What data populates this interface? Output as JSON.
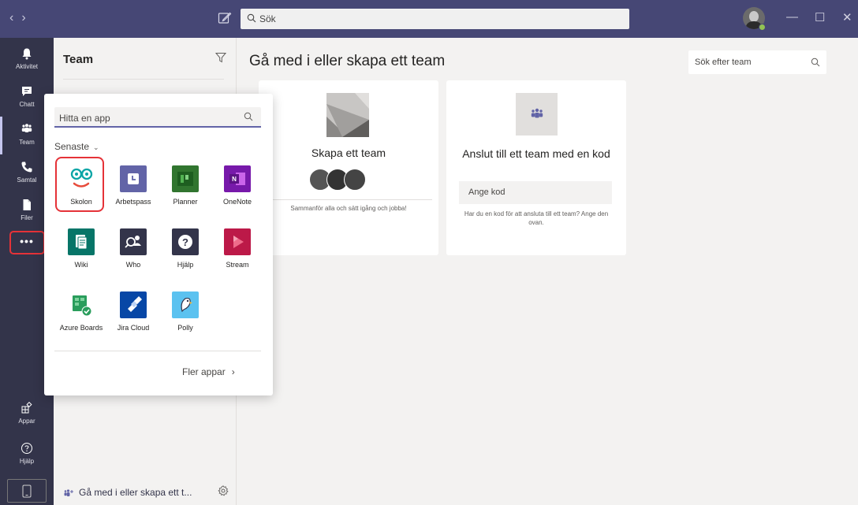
{
  "titlebar": {
    "nav_back": "‹",
    "nav_forward": "›",
    "search_placeholder": "Sök",
    "minimize": "—",
    "maximize": "☐",
    "close": "✕"
  },
  "appbar": {
    "items": [
      {
        "label": "Aktivitet",
        "icon": "bell-icon"
      },
      {
        "label": "Chatt",
        "icon": "chat-icon"
      },
      {
        "label": "Team",
        "icon": "teams-icon"
      },
      {
        "label": "Samtal",
        "icon": "phone-icon"
      },
      {
        "label": "Filer",
        "icon": "file-icon"
      }
    ],
    "more": "•••",
    "bottom": [
      {
        "label": "Appar",
        "icon": "apps-icon"
      },
      {
        "label": "Hjälp",
        "icon": "help-icon"
      }
    ]
  },
  "team_panel": {
    "title": "Team",
    "join_label": "Gå med i eller skapa ett t..."
  },
  "main": {
    "title": "Gå med i eller skapa ett team",
    "search_placeholder": "Sök efter team",
    "create_card": {
      "title": "Skapa ett team",
      "description": "Sammanför alla och sätt igång och jobba!"
    },
    "code_card": {
      "title": "Anslut till ett team med en kod",
      "input_placeholder": "Ange kod",
      "description": "Har du en kod för att ansluta till ett team? Ange den ovan."
    }
  },
  "flyout": {
    "search_placeholder": "Hitta en app",
    "recent_label": "Senaste",
    "more_apps": "Fler appar",
    "apps": [
      {
        "name": "Skolon",
        "icon": "skolon-icon",
        "color": "#ffffff"
      },
      {
        "name": "Arbetspass",
        "icon": "clock-icon",
        "color": "#6264a7"
      },
      {
        "name": "Planner",
        "icon": "planner-icon",
        "color": "#31752f"
      },
      {
        "name": "OneNote",
        "icon": "onenote-icon",
        "color": "#7719aa"
      },
      {
        "name": "Wiki",
        "icon": "wiki-icon",
        "color": "#077568"
      },
      {
        "name": "Who",
        "icon": "who-icon",
        "color": "#33344a"
      },
      {
        "name": "Hjälp",
        "icon": "help-circle-icon",
        "color": "#33344a"
      },
      {
        "name": "Stream",
        "icon": "stream-icon",
        "color": "#bc1948"
      },
      {
        "name": "Azure Boards",
        "icon": "azure-boards-icon",
        "color": "#ffffff"
      },
      {
        "name": "Jira Cloud",
        "icon": "jira-icon",
        "color": "#0747a6"
      },
      {
        "name": "Polly",
        "icon": "polly-icon",
        "color": "#5bc2f0"
      }
    ]
  },
  "colors": {
    "titlebar": "#464775",
    "appbar": "#33344a",
    "accent": "#6264a7",
    "highlight": "#e53238"
  }
}
